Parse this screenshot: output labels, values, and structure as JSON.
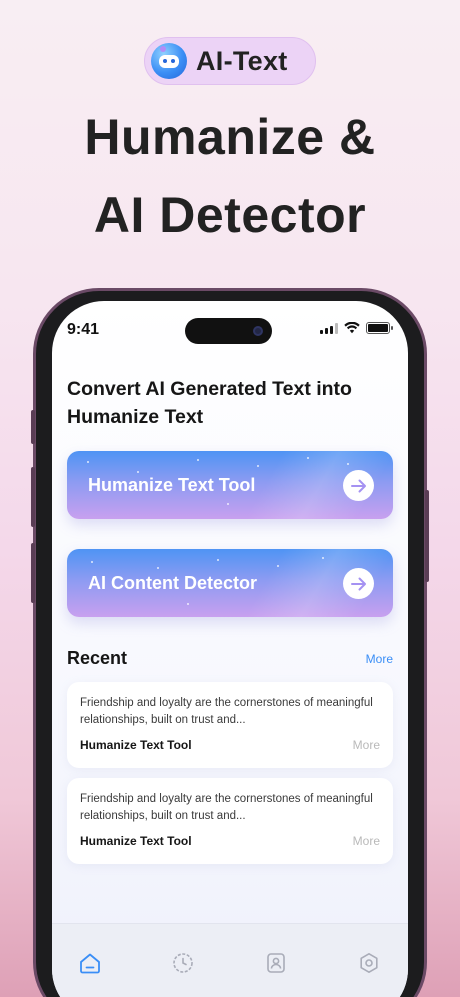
{
  "badge": {
    "text": "AI-Text",
    "logo_icon": "robot-icon"
  },
  "headline": {
    "line1": "Humanize &",
    "line2": "AI Detector"
  },
  "status_bar": {
    "time": "9:41"
  },
  "page": {
    "title": "Convert AI Generated Text into Humanize Text"
  },
  "tools": [
    {
      "label": "Humanize Text Tool",
      "icon": "arrow-right-icon"
    },
    {
      "label": "AI Content Detector",
      "icon": "arrow-right-icon"
    }
  ],
  "recent": {
    "title": "Recent",
    "more_label": "More",
    "items": [
      {
        "snippet": "Friendship and loyalty are the cornerstones of meaningful relationships, built on trust and...",
        "tool": "Humanize Text Tool",
        "more": "More"
      },
      {
        "snippet": "Friendship and loyalty are the cornerstones of meaningful relationships, built on trust and...",
        "tool": "Humanize Text Tool",
        "more": "More"
      }
    ]
  },
  "tabbar": {
    "tabs": [
      {
        "icon": "home-icon",
        "active": true
      },
      {
        "icon": "clock-icon",
        "active": false
      },
      {
        "icon": "profile-icon",
        "active": false
      },
      {
        "icon": "settings-icon",
        "active": false
      }
    ]
  },
  "colors": {
    "accent": "#3a8ef6",
    "card_gradient_top": "#4f94f4",
    "card_gradient_bottom": "#c8a0ef"
  }
}
